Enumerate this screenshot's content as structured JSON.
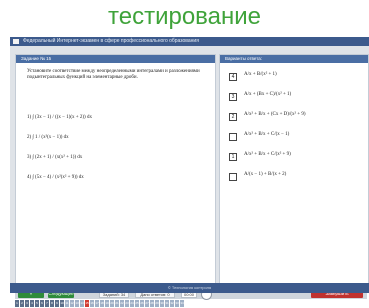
{
  "slide": {
    "title": "тестирование"
  },
  "app": {
    "title": "Федеральный Интернет-экзамен в сфере профессионального образования",
    "footer": "© Технология контроля"
  },
  "task": {
    "header": "Задание № 15",
    "question": "Установите соответствие между неопределенными интегралами и разложениями подынтегральных функций на элементарные дроби.",
    "items": [
      "1) ∫ (3x − 1) / ((x − 1)(x + 2)) dx",
      "2) ∫ 1 / (x²(x − 1)) dx",
      "3) ∫ (2x + 1) / (x(x² + 1)) dx",
      "4) ∫ (5x − 4) / (x²(x² + 9)) dx"
    ]
  },
  "answers": {
    "header": "Варианты ответа:",
    "options": [
      {
        "mark": "4",
        "expr": "A/x + B/(x² + 1)"
      },
      {
        "mark": "3",
        "expr": "A/x + (Bx + C)/(x² + 1)"
      },
      {
        "mark": "2",
        "expr": "A/x² + B/x + (Cx + D)/(x² + 9)"
      },
      {
        "mark": "",
        "expr": "A/x² + B/x + C/(x − 1)"
      },
      {
        "mark": "1",
        "expr": "A/x² + B/x + C/(x² + 9)"
      },
      {
        "mark": "",
        "expr": "A/(x − 1) + B/(x + 2)"
      }
    ]
  },
  "nav": {
    "prev_label": "« Предыдущее",
    "next_label": "Следующее »",
    "task_count": "Заданий: 34",
    "answered_count": "Дано ответов: 0",
    "timer": "00:00",
    "finish_label": "Завершить тестирование",
    "questions": [
      {
        "n": "1",
        "state": "done"
      },
      {
        "n": "2",
        "state": "done"
      },
      {
        "n": "3",
        "state": "done"
      },
      {
        "n": "4",
        "state": "done"
      },
      {
        "n": "5",
        "state": "done"
      },
      {
        "n": "6",
        "state": "done"
      },
      {
        "n": "7",
        "state": "done"
      },
      {
        "n": "8",
        "state": "done"
      },
      {
        "n": "9",
        "state": "done"
      },
      {
        "n": "10",
        "state": "done"
      },
      {
        "n": "11",
        "state": "todo"
      },
      {
        "n": "12",
        "state": "todo"
      },
      {
        "n": "13",
        "state": "todo"
      },
      {
        "n": "14",
        "state": "todo"
      },
      {
        "n": "15",
        "state": "current"
      },
      {
        "n": "16",
        "state": "todo"
      },
      {
        "n": "17",
        "state": "todo"
      },
      {
        "n": "18",
        "state": "todo"
      },
      {
        "n": "19",
        "state": "todo"
      },
      {
        "n": "20",
        "state": "todo"
      },
      {
        "n": "21",
        "state": "todo"
      },
      {
        "n": "22",
        "state": "todo"
      },
      {
        "n": "23",
        "state": "todo"
      },
      {
        "n": "24",
        "state": "todo"
      },
      {
        "n": "25",
        "state": "todo"
      },
      {
        "n": "26",
        "state": "todo"
      },
      {
        "n": "27",
        "state": "todo"
      },
      {
        "n": "28",
        "state": "todo"
      },
      {
        "n": "29",
        "state": "todo"
      },
      {
        "n": "30",
        "state": "todo"
      },
      {
        "n": "31",
        "state": "todo"
      },
      {
        "n": "32",
        "state": "todo"
      },
      {
        "n": "33",
        "state": "todo"
      },
      {
        "n": "34",
        "state": "todo"
      }
    ],
    "state_colors": {
      "done": "#5c6f8a",
      "todo": "#9fb0c6",
      "current": "#d23c32"
    }
  }
}
